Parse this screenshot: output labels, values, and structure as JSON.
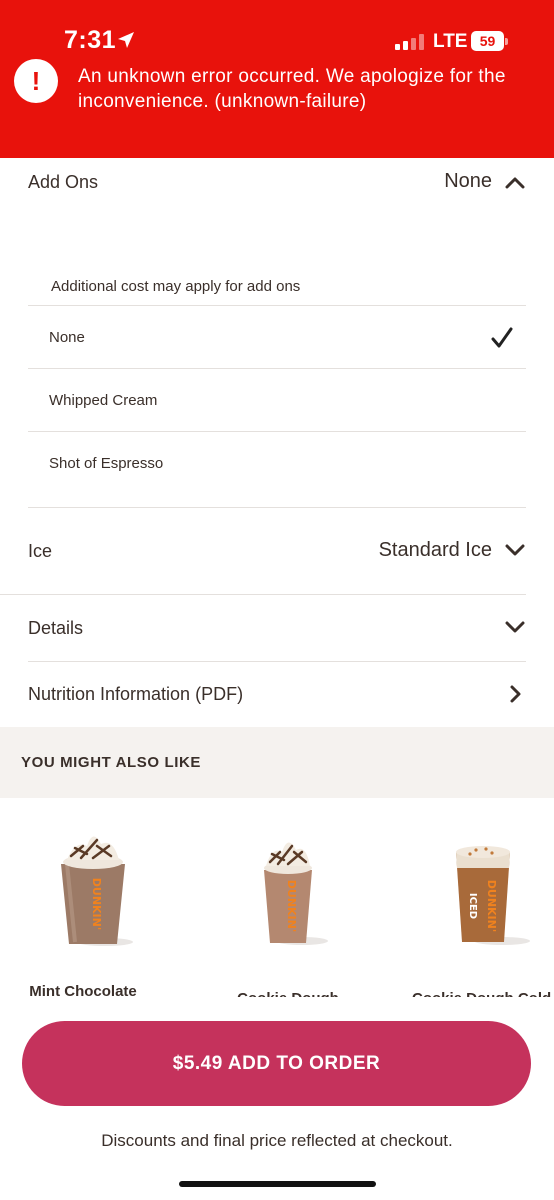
{
  "status_bar": {
    "time": "7:31",
    "network": "LTE",
    "battery": "59"
  },
  "error_banner": {
    "icon": "!",
    "message": "An unknown error occurred. We apologize for the inconvenience. (unknown-failure)"
  },
  "add_ons": {
    "label": "Add Ons",
    "value": "None",
    "note": "Additional cost may apply for add ons",
    "options": [
      {
        "label": "None",
        "selected": true
      },
      {
        "label": "Whipped Cream",
        "selected": false
      },
      {
        "label": "Shot of Espresso",
        "selected": false
      }
    ]
  },
  "ice": {
    "label": "Ice",
    "value": "Standard Ice"
  },
  "details": {
    "label": "Details"
  },
  "nutrition": {
    "label": "Nutrition Information (PDF)"
  },
  "recommendations": {
    "title": "YOU MIGHT ALSO LIKE",
    "items": [
      {
        "name": "Mint Chocolate",
        "brand": "DUNKIN'"
      },
      {
        "name": "Cookie Dough",
        "brand": "DUNKIN'"
      },
      {
        "name": "Cookie Dough Cold",
        "brand": "DUNKIN'",
        "badge": "ICED"
      }
    ]
  },
  "order": {
    "button_label": "$5.49 ADD TO ORDER",
    "note": "Discounts and final price reflected at checkout."
  },
  "colors": {
    "error_red": "#e8120c",
    "button_pink": "#c5325c",
    "text_brown": "#3a2f2a",
    "section_bg": "#f5f2ef",
    "dunkin_orange": "#f0821e"
  },
  "icons": {
    "location": "location-arrow-icon",
    "alert": "exclamation-icon",
    "chevron_up": "chevron-up-icon",
    "chevron_down": "chevron-down-icon",
    "chevron_right": "chevron-right-icon",
    "check": "checkmark-icon"
  }
}
